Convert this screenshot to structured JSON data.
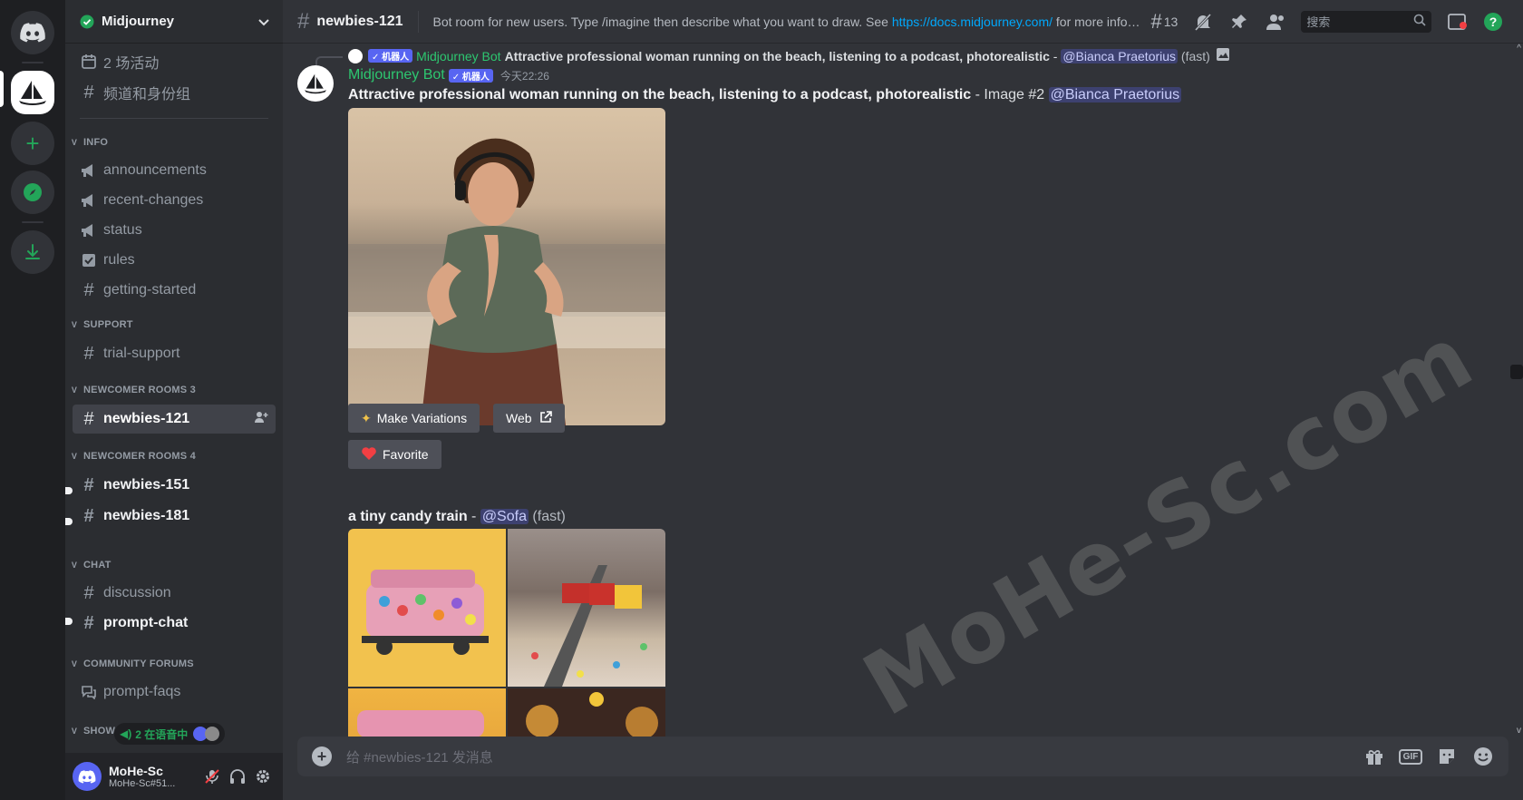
{
  "guild": {
    "name": "Midjourney"
  },
  "sidebar": {
    "top_items": [
      {
        "label": "2 场活动",
        "icon": "calendar-icon"
      },
      {
        "label": "频道和身份组",
        "icon": "hashtag-grid-icon"
      }
    ],
    "categories": {
      "info": "INFO",
      "support": "SUPPORT",
      "newcomer3": "NEWCOMER ROOMS 3",
      "newcomer4": "NEWCOMER ROOMS 4",
      "chat": "CHAT",
      "forums": "COMMUNITY FORUMS",
      "showcase": "SHOWC"
    },
    "channels": {
      "announcements": "announcements",
      "recent_changes": "recent-changes",
      "status": "status",
      "rules": "rules",
      "getting_started": "getting-started",
      "trial_support": "trial-support",
      "newbies_121": "newbies-121",
      "newbies_151": "newbies-151",
      "newbies_181": "newbies-181",
      "discussion": "discussion",
      "prompt_chat": "prompt-chat",
      "prompt_faqs": "prompt-faqs"
    },
    "voice_badge": "2 在语音中"
  },
  "user": {
    "name": "MoHe-Sc",
    "tag": "MoHe-Sc#51..."
  },
  "topbar": {
    "channel": "newbies-121",
    "topic_prefix": "Bot room for new users. Type /imagine then describe what you want to draw. See ",
    "topic_link": "https://docs.midjourney.com/",
    "topic_suffix": " for more inform...",
    "threads_count": "13",
    "search_placeholder": "搜索"
  },
  "reply": {
    "author": "Midjourney Bot",
    "bot_tag": "✓ 机器人",
    "prompt": "Attractive professional woman running on the beach, listening to a podcast, photorealistic",
    "dash": " - ",
    "mention": "@Bianca Praetorius",
    "speed": " (fast)"
  },
  "message": {
    "author": "Midjourney Bot",
    "bot_tag": "✓ 机器人",
    "timestamp": "今天22:26",
    "prompt": "Attractive professional woman running on the beach, listening to a podcast, photorealistic",
    "suffix": " - Image #2 ",
    "mention": "@Bianca Praetorius",
    "buttons": {
      "variations": "Make Variations",
      "web": "Web",
      "favorite": "Favorite"
    }
  },
  "message2": {
    "prompt": "a tiny candy train",
    "dash": " - ",
    "mention": "@Sofa",
    "speed": " (fast)"
  },
  "composer": {
    "placeholder": "给 #newbies-121 发消息",
    "gif": "GIF"
  },
  "watermark": "MoHe-Sc.com",
  "colors": {
    "brand": "#5865f2",
    "green": "#23a559",
    "bot_name": "#2dc770",
    "link": "#00a8fc"
  }
}
